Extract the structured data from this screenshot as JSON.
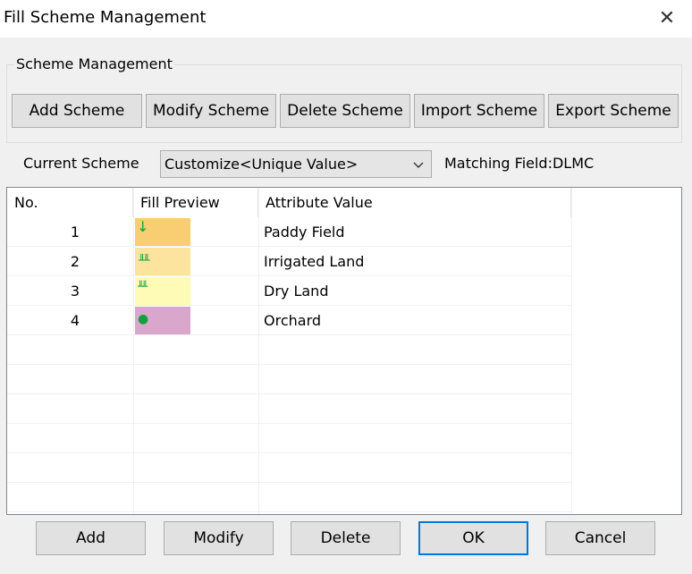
{
  "window": {
    "title": "Fill Scheme Management",
    "close_icon": "✕"
  },
  "scheme_management": {
    "label": "Scheme Management",
    "buttons": [
      "Add Scheme",
      "Modify Scheme",
      "Delete Scheme",
      "Import Scheme",
      "Export Scheme"
    ]
  },
  "current_scheme": {
    "label": "Current Scheme",
    "value": "Customize<Unique Value>",
    "dropdown_icon": "chevron-down-icon",
    "matching_field": "Matching Field:DLMC"
  },
  "table": {
    "columns": [
      "No.",
      "Fill Preview",
      "Attribute Value"
    ],
    "rows": [
      {
        "no": "1",
        "attribute": "Paddy Field",
        "color": "#f9cd72",
        "icon": "↓",
        "icon_name": "arrow-down-icon"
      },
      {
        "no": "2",
        "attribute": "Irrigated Land",
        "color": "#fce39e",
        "icon": "╨╨",
        "icon_name": "irrigated-symbol-icon"
      },
      {
        "no": "3",
        "attribute": "Dry Land",
        "color": "#fefbb6",
        "icon": "╨╨",
        "icon_name": "dry-land-symbol-icon"
      },
      {
        "no": "4",
        "attribute": "Orchard",
        "color": "#d9a6cc",
        "icon": "●",
        "icon_name": "orchard-dot-icon"
      }
    ]
  },
  "footer": {
    "buttons": [
      "Add",
      "Modify",
      "Delete",
      "OK",
      "Cancel"
    ]
  },
  "colors": {
    "accent": "#0078d7",
    "button_bg": "#e1e1e1",
    "symbol_green": "#10a040"
  }
}
